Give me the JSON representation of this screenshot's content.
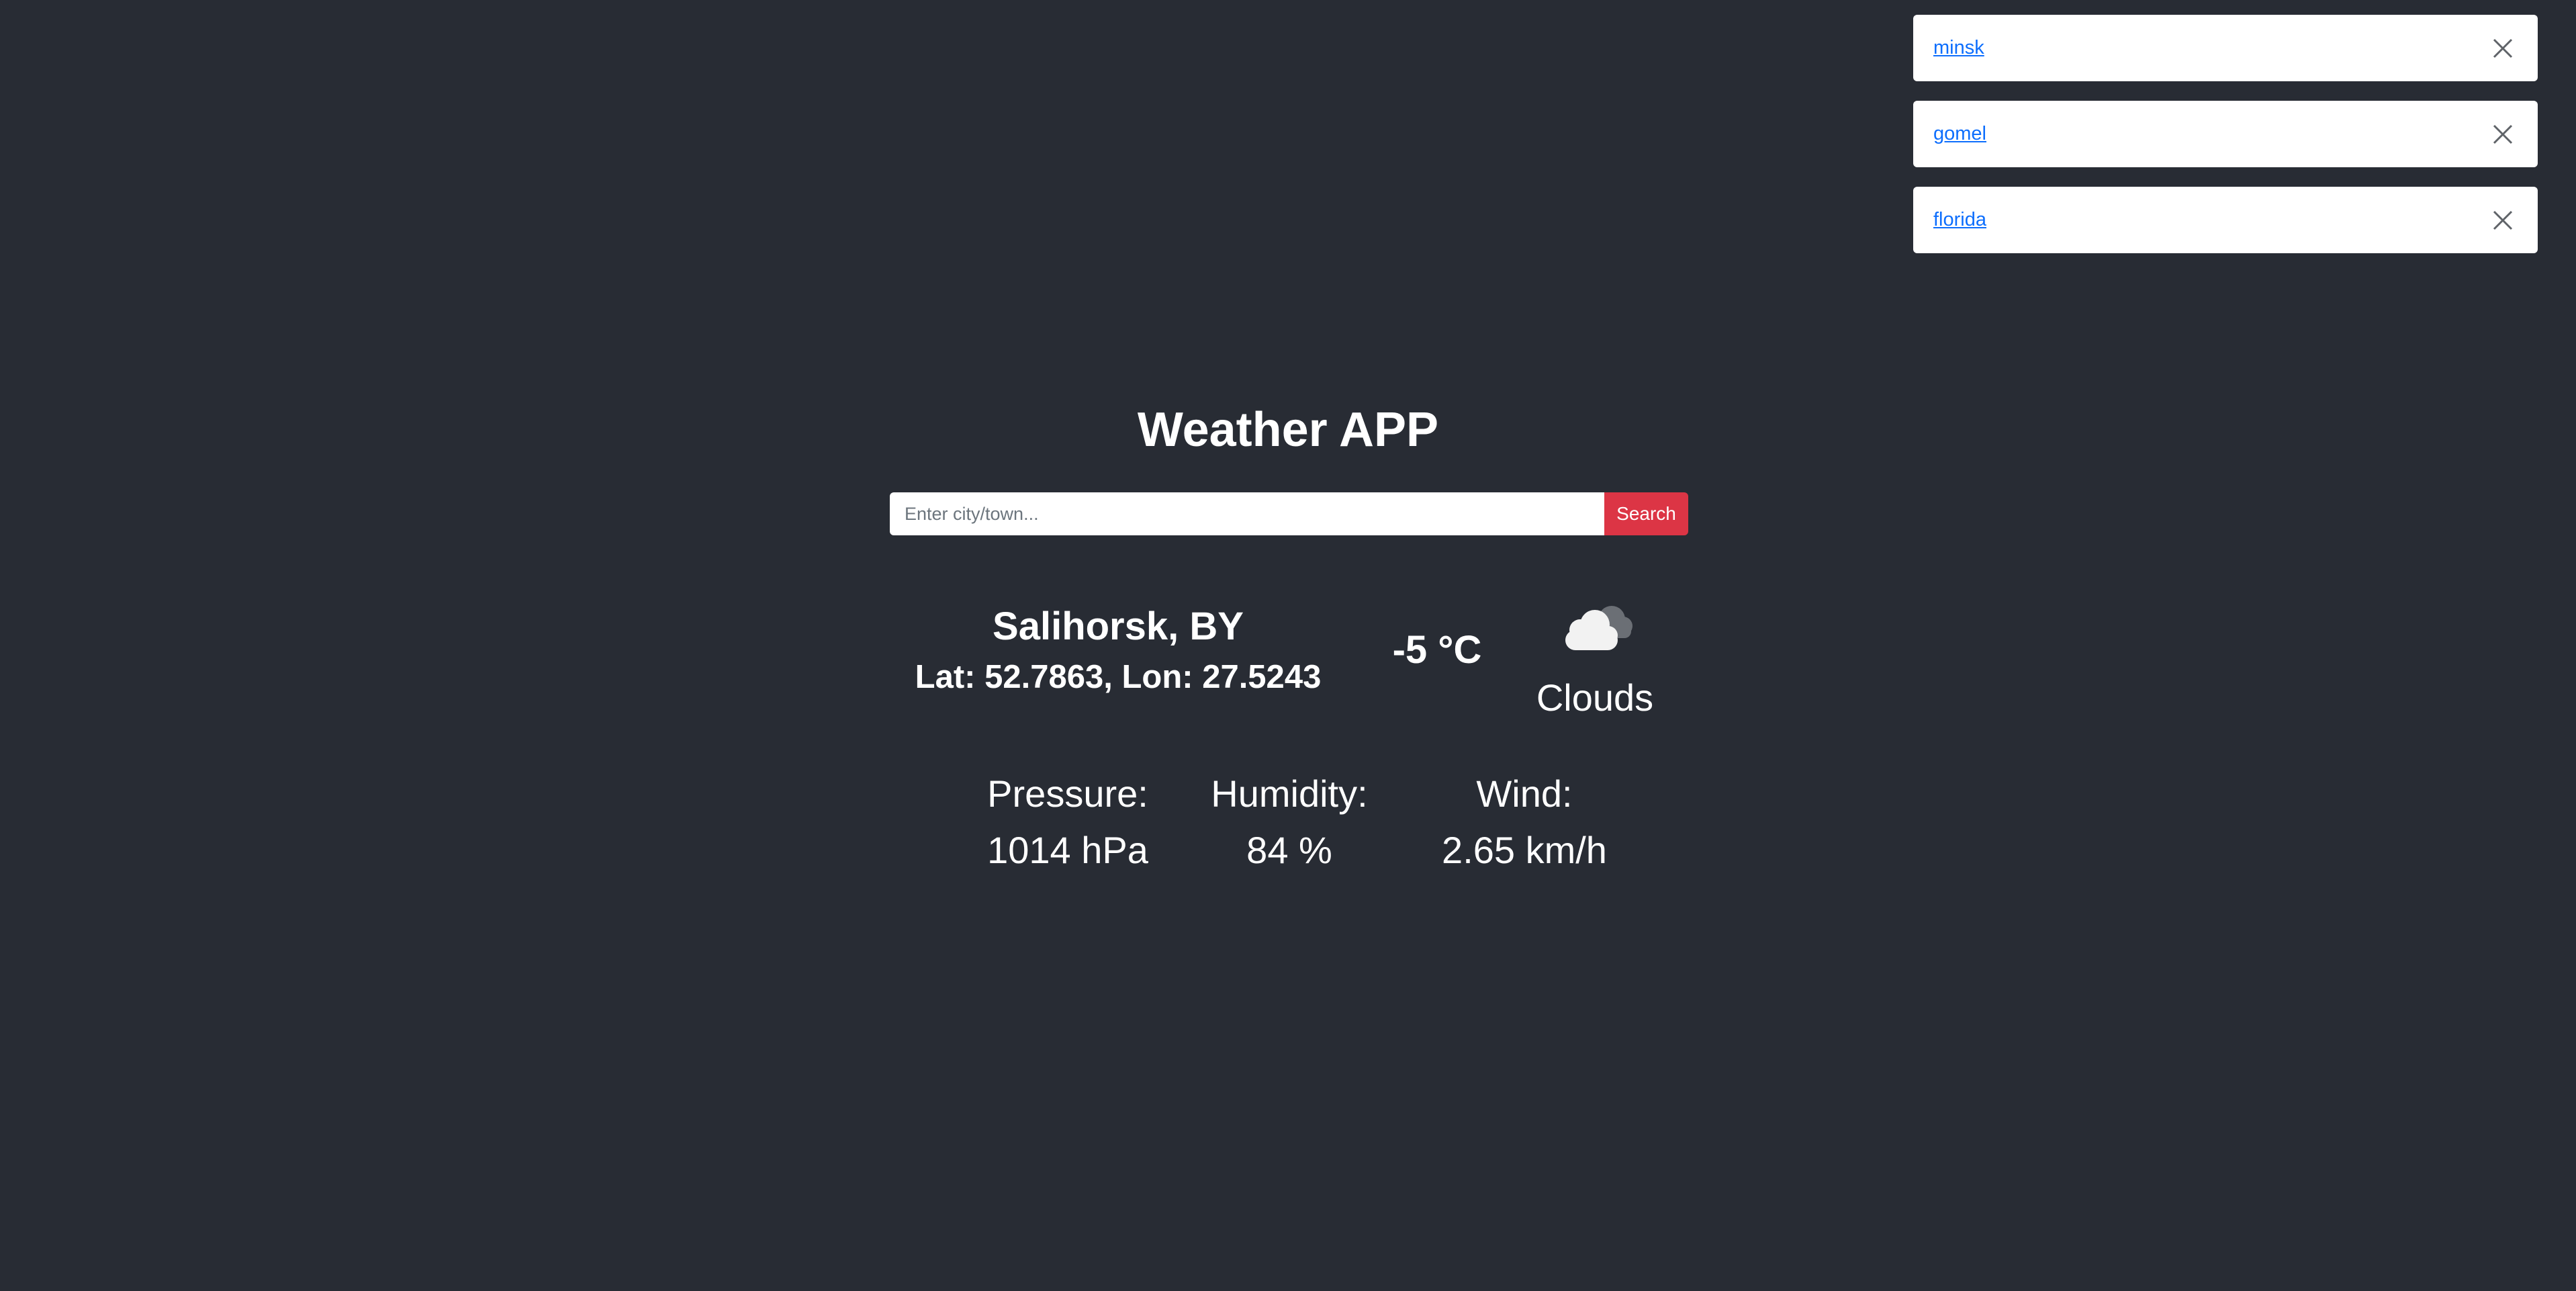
{
  "history": [
    {
      "label": "minsk"
    },
    {
      "label": "gomel"
    },
    {
      "label": "florida"
    }
  ],
  "app": {
    "title": "Weather APP",
    "search": {
      "placeholder": "Enter city/town...",
      "value": "",
      "button_label": "Search",
      "button_color": "#dc3545"
    }
  },
  "weather": {
    "city": "Salihorsk, BY",
    "lat_label": "Lat: 52.7863,",
    "lon_label": "Lon: 27.5243",
    "temperature": "-5 °C",
    "condition": "Clouds",
    "icon": "clouds-icon",
    "stats": {
      "pressure_label": "Pressure:",
      "pressure_value": "1014 hPa",
      "humidity_label": "Humidity:",
      "humidity_value": "84 %",
      "wind_label": "Wind:",
      "wind_value": "2.65 km/h"
    }
  },
  "colors": {
    "background": "#282c34",
    "link": "#0d6efd",
    "accent": "#dc3545"
  }
}
